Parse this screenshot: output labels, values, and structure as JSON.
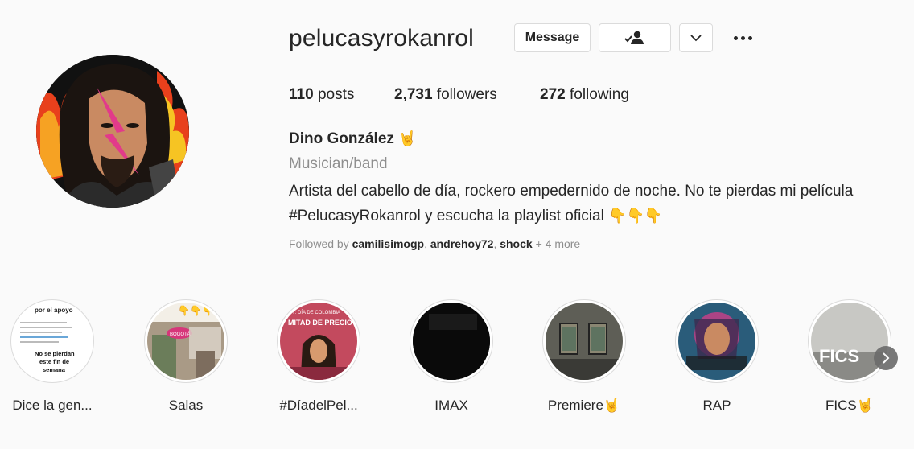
{
  "profile": {
    "username": "pelucasyrokanrol",
    "message_label": "Message",
    "posts_count": "110",
    "posts_label": "posts",
    "followers_count": "2,731",
    "followers_label": "followers",
    "following_count": "272",
    "following_label": "following",
    "full_name": "Dino González",
    "category": "Musician/band",
    "bio_line1": "Artista del cabello de día, rockero empedernido de noche. No te pierdas mi película",
    "bio_line2": "#PelucasyRokanrol y escucha la playlist oficial",
    "followed_by_prefix": "Followed by",
    "followed_by_names": [
      "camilisimogp",
      "andrehoy72",
      "shock"
    ],
    "followed_by_more": "+ 4 more"
  },
  "highlights": [
    {
      "label": "Dice la gen...",
      "color": "#ffffff",
      "text_a": "por el apoyo",
      "text_b": "No se pierdan este fin de semana"
    },
    {
      "label": "Salas",
      "color": "#b9a894",
      "text_a": "BOGOTÁ"
    },
    {
      "label": "#DíadelPel...",
      "color": "#c34a5e",
      "text_a": "HOY: DÍA DE COLOMBIA",
      "text_b": "MITAD DE PRECIO"
    },
    {
      "label": "IMAX",
      "color": "#0a0a0a"
    },
    {
      "label": "Premiere",
      "color": "#6b6b63"
    },
    {
      "label": "RAP",
      "color": "#2a5c7a"
    },
    {
      "label": "FICS",
      "color": "#c8c8c4",
      "text_a": "FICS"
    }
  ],
  "colors": {
    "text": "#262626",
    "muted": "#8e8e8e",
    "border": "#dbdbdb",
    "emoji": "#e8a514"
  },
  "icons": [
    "person-check-icon",
    "chevron-down-icon",
    "more-icon",
    "chevron-right-icon",
    "rock-hand-icon",
    "pointing-down-icon"
  ]
}
